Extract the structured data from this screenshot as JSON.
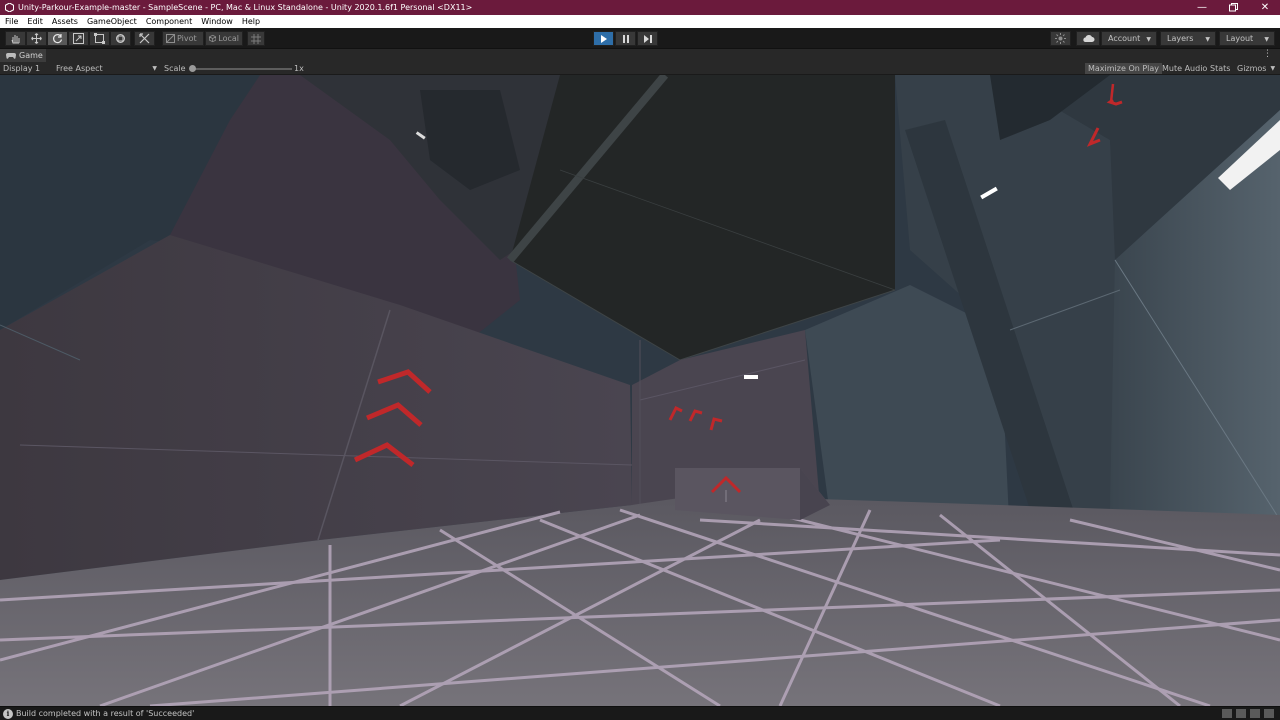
{
  "window": {
    "title": "Unity-Parkour-Example-master - SampleScene - PC, Mac & Linux Standalone - Unity 2020.1.6f1 Personal <DX11>",
    "title_bar_color": "#6b1a3c"
  },
  "menu": {
    "items": [
      "File",
      "Edit",
      "Assets",
      "GameObject",
      "Component",
      "Window",
      "Help"
    ]
  },
  "toolbar": {
    "tools": [
      "hand-tool",
      "move-tool",
      "rotate-tool",
      "scale-tool",
      "rect-tool",
      "transform-tool",
      "custom-tool"
    ],
    "active_tool": "rotate-tool",
    "pivot_label": "Pivot",
    "local_label": "Local",
    "play_state": "playing",
    "account_label": "Account",
    "layers_label": "Layers",
    "layout_label": "Layout",
    "accent_color": "#2e6ea8"
  },
  "game_tab": {
    "label": "Game"
  },
  "game_bar": {
    "display": "Display 1",
    "aspect": "Free Aspect",
    "scale_label": "Scale",
    "scale_value": "1x",
    "maximize_on_play": "Maximize On Play",
    "mute_audio": "Mute Audio",
    "stats": "Stats",
    "gizmos": "Gizmos"
  },
  "viewport": {
    "scene": "parkour level with grid floor and red chevron markers",
    "marker_color": "#c0282a"
  },
  "status": {
    "message": "Build completed with a result of 'Succeeded'"
  }
}
